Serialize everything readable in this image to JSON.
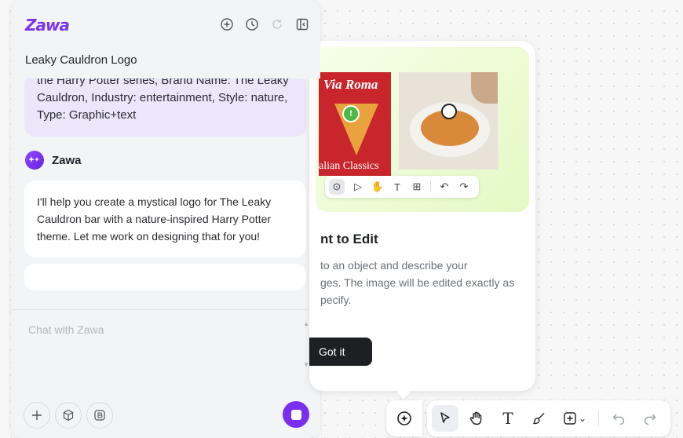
{
  "app": {
    "logo_text": "Zawa"
  },
  "header": {
    "title": "Leaky Cauldron Logo"
  },
  "conversation": {
    "user_message_lines": [
      "the Harry Potter series, Brand Name: The Leaky",
      "Cauldron, Industry: entertainment, Style: nature,",
      "Type: Graphic+text"
    ],
    "agent_name": "Zawa",
    "agent_message": "I'll help you create a mystical logo for The Leaky Cauldron bar with a nature-inspired Harry Potter theme. Let me work on designing that for you!"
  },
  "composer": {
    "placeholder": "Chat with Zawa",
    "value": ""
  },
  "tooltip": {
    "title_visible": "nt to Edit",
    "description": "to an object and describe your ges. The image will be edited exactly as pecify.",
    "desc_lines": [
      "to an object and describe your",
      "ges. The image will be edited exactly as",
      "pecify."
    ],
    "button_label": "Got it",
    "image1_brand": "Via Roma",
    "image1_tagline": "alian Classics"
  },
  "toolbar": {
    "text_tool_glyph": "T",
    "dropdown_glyph": "⌄"
  },
  "colors": {
    "brand": "#7a2ef0",
    "accent_green": "#4cb848",
    "dark_button": "#1d1f23"
  }
}
